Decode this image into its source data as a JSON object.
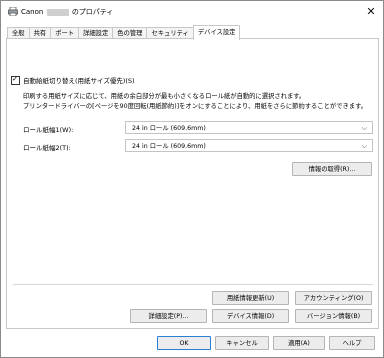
{
  "window": {
    "title_prefix": "Canon",
    "title_suffix": "のプロパティ",
    "close_glyph": "✕"
  },
  "tabs": [
    {
      "label": "全般"
    },
    {
      "label": "共有"
    },
    {
      "label": "ポート"
    },
    {
      "label": "詳細設定"
    },
    {
      "label": "色の管理"
    },
    {
      "label": "セキュリティ"
    },
    {
      "label": "デバイス設定"
    }
  ],
  "active_tab_index": 6,
  "device_settings": {
    "auto_switch": {
      "label": "自動給紙切り替え(用紙サイズ優先)(S)",
      "checked": true
    },
    "description_lines": [
      "印刷する用紙サイズに応じて、用紙の余白部分が最も小さくなるロール紙が自動的に選択されます。",
      "プリンタードライバーの[ページを90度回転(用紙節約)]をオンにすることにより、用紙をさらに節約することができます。"
    ],
    "roll1": {
      "label": "ロール紙幅1(W):",
      "value": "24 in ロール (609.6mm)"
    },
    "roll2": {
      "label": "ロール紙幅2(T):",
      "value": "24 in ロール (609.6mm)"
    },
    "get_info_button": "情報の取得(R)...",
    "update_paper_info_button": "用紙情報更新(U)",
    "accounting_button": "アカウンティング(O)",
    "advanced_settings_button": "詳細設定(P)...",
    "device_info_button": "デバイス情報(D)",
    "version_info_button": "バージョン情報(B)"
  },
  "footer": {
    "ok": "OK",
    "cancel": "キャンセル",
    "apply": "適用(A)",
    "help": "ヘルプ"
  },
  "icons": {
    "dropdown": "chevron-down-icon",
    "printer": "printer-icon",
    "close": "close-icon"
  },
  "colors": {
    "primary_button_border": "#2a7fd4"
  }
}
